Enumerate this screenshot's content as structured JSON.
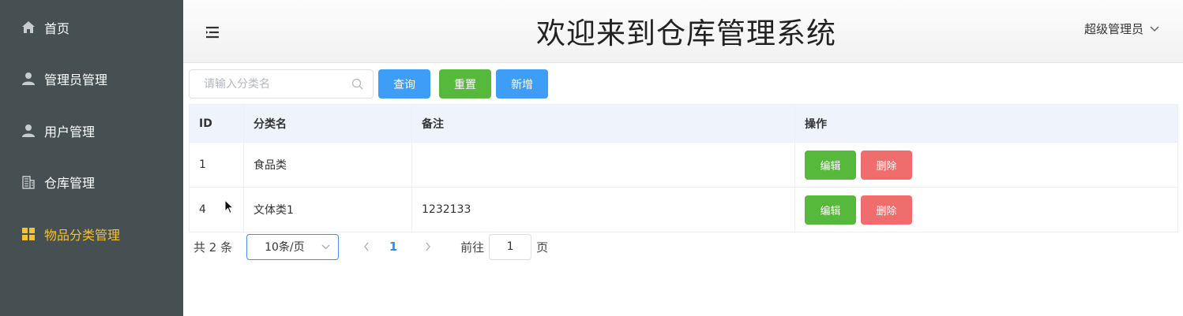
{
  "sidebar": {
    "items": [
      {
        "label": "首页",
        "icon": "home-icon"
      },
      {
        "label": "管理员管理",
        "icon": "user-icon"
      },
      {
        "label": "用户管理",
        "icon": "user-icon"
      },
      {
        "label": "仓库管理",
        "icon": "building-icon"
      },
      {
        "label": "物品分类管理",
        "icon": "grid-icon",
        "active": true
      }
    ],
    "active_color": "#f5c230",
    "background": "#464f51"
  },
  "header": {
    "title": "欢迎来到仓库管理系统",
    "user": "超级管理员"
  },
  "toolbar": {
    "search_placeholder": "请输入分类名",
    "search_value": "",
    "query_label": "查询",
    "reset_label": "重置",
    "add_label": "新增"
  },
  "table": {
    "columns": [
      "ID",
      "分类名",
      "备注",
      "操作"
    ],
    "rows": [
      {
        "id": "1",
        "name": "食品类",
        "remark": ""
      },
      {
        "id": "4",
        "name": "文体类1",
        "remark": "1232133"
      }
    ],
    "edit_label": "编辑",
    "delete_label": "删除"
  },
  "pagination": {
    "total_text": "共 2 条",
    "page_size": "10条/页",
    "current_page": "1",
    "goto_label": "前往",
    "goto_value": "1",
    "page_unit": "页"
  },
  "colors": {
    "primary": "#3e9df6",
    "success": "#57b93b",
    "danger": "#ef6d6d"
  }
}
